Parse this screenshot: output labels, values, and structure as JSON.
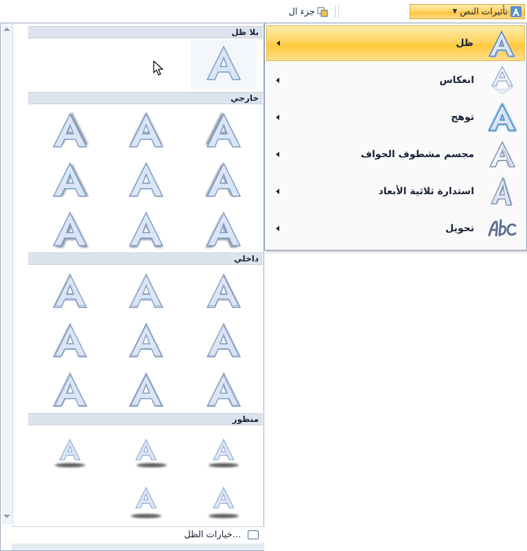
{
  "ribbon": {
    "text_effects_label": "تأثيرات النص",
    "part_label": "جزء ال"
  },
  "menu": {
    "items": [
      {
        "label": "ظل",
        "icon": "shadow-a-icon",
        "active": true
      },
      {
        "label": "انعكاس",
        "icon": "reflection-a-icon",
        "active": false
      },
      {
        "label": "توهج",
        "icon": "glow-a-icon",
        "active": false
      },
      {
        "label": "مجسم مشطوف الحواف",
        "icon": "bevel-a-icon",
        "active": false
      },
      {
        "label": "استدارة ثلاثية الأبعاد",
        "icon": "3d-rotation-a-icon",
        "active": false
      },
      {
        "label": "تحويل",
        "icon": "transform-abc-icon",
        "active": false
      }
    ]
  },
  "gallery": {
    "sections": [
      {
        "title": "بلا ظل"
      },
      {
        "title": "خارجي"
      },
      {
        "title": "داخلي"
      },
      {
        "title": "منظور"
      }
    ],
    "options_label": "خيارات الظل...",
    "grip_label": "····"
  },
  "colors": {
    "accent_highlight": "#ffd663",
    "header_bg": "#dde3ec",
    "letter_fill": "#d9e6f7",
    "letter_stroke": "#7a97c2"
  }
}
